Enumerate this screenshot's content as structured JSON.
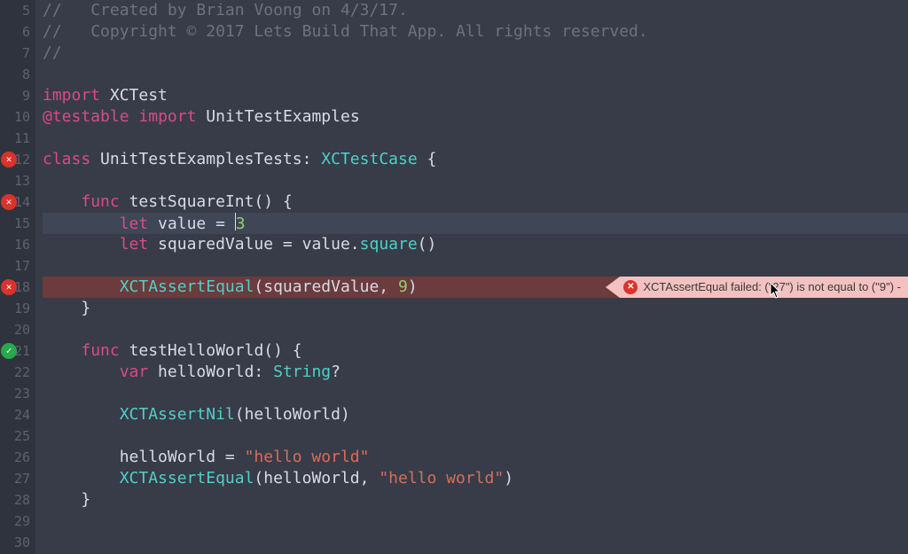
{
  "first_line_number": 5,
  "error_annotation": {
    "line_number": 18,
    "message": "XCTAssertEqual failed: (\"27\") is not equal to (\"9\") -"
  },
  "gutter_markers": [
    {
      "line_number": 12,
      "kind": "fail",
      "glyph": "✕"
    },
    {
      "line_number": 14,
      "kind": "fail",
      "glyph": "✕"
    },
    {
      "line_number": 18,
      "kind": "fail",
      "glyph": "✕"
    },
    {
      "line_number": 21,
      "kind": "pass",
      "glyph": "✓"
    }
  ],
  "current_line_number": 15,
  "error_line_number": 18,
  "lines": [
    {
      "n": 5,
      "tokens": [
        {
          "t": "// ",
          "c": "comment"
        },
        {
          "t": "  Created by Brian Voong on 4/3/17.",
          "c": "comment"
        }
      ]
    },
    {
      "n": 6,
      "tokens": [
        {
          "t": "// ",
          "c": "comment"
        },
        {
          "t": "  Copyright © 2017 Lets Build That App. All rights reserved.",
          "c": "comment"
        }
      ]
    },
    {
      "n": 7,
      "tokens": [
        {
          "t": "//",
          "c": "comment"
        }
      ]
    },
    {
      "n": 8,
      "tokens": []
    },
    {
      "n": 9,
      "tokens": [
        {
          "t": "import",
          "c": "keyword"
        },
        {
          "t": " ",
          "c": "plain"
        },
        {
          "t": "XCTest",
          "c": "plain"
        }
      ]
    },
    {
      "n": 10,
      "tokens": [
        {
          "t": "@testable",
          "c": "keyword2"
        },
        {
          "t": " ",
          "c": "plain"
        },
        {
          "t": "import",
          "c": "keyword"
        },
        {
          "t": " ",
          "c": "plain"
        },
        {
          "t": "UnitTestExamples",
          "c": "plain"
        }
      ]
    },
    {
      "n": 11,
      "tokens": []
    },
    {
      "n": 12,
      "tokens": [
        {
          "t": "class",
          "c": "keyword"
        },
        {
          "t": " ",
          "c": "plain"
        },
        {
          "t": "UnitTestExamplesTests",
          "c": "plain"
        },
        {
          "t": ": ",
          "c": "punct"
        },
        {
          "t": "XCTestCase",
          "c": "type"
        },
        {
          "t": " {",
          "c": "punct"
        }
      ]
    },
    {
      "n": 13,
      "tokens": []
    },
    {
      "n": 14,
      "tokens": [
        {
          "t": "    ",
          "c": "plain"
        },
        {
          "t": "func",
          "c": "keyword"
        },
        {
          "t": " ",
          "c": "plain"
        },
        {
          "t": "testSquareInt",
          "c": "plain"
        },
        {
          "t": "() {",
          "c": "punct"
        }
      ]
    },
    {
      "n": 15,
      "tokens": [
        {
          "t": "        ",
          "c": "plain"
        },
        {
          "t": "let",
          "c": "keyword"
        },
        {
          "t": " value = ",
          "c": "plain"
        },
        {
          "t": "|",
          "c": "cursor"
        },
        {
          "t": "3",
          "c": "number"
        }
      ]
    },
    {
      "n": 16,
      "tokens": [
        {
          "t": "        ",
          "c": "plain"
        },
        {
          "t": "let",
          "c": "keyword"
        },
        {
          "t": " squaredValue = value.",
          "c": "plain"
        },
        {
          "t": "square",
          "c": "fn"
        },
        {
          "t": "()",
          "c": "punct"
        }
      ]
    },
    {
      "n": 17,
      "tokens": []
    },
    {
      "n": 18,
      "tokens": [
        {
          "t": "        ",
          "c": "plain"
        },
        {
          "t": "XCTAssertEqual",
          "c": "fn"
        },
        {
          "t": "(squaredValue, ",
          "c": "plain"
        },
        {
          "t": "9",
          "c": "number"
        },
        {
          "t": ")",
          "c": "punct"
        }
      ]
    },
    {
      "n": 19,
      "tokens": [
        {
          "t": "    }",
          "c": "punct"
        }
      ]
    },
    {
      "n": 20,
      "tokens": []
    },
    {
      "n": 21,
      "tokens": [
        {
          "t": "    ",
          "c": "plain"
        },
        {
          "t": "func",
          "c": "keyword"
        },
        {
          "t": " ",
          "c": "plain"
        },
        {
          "t": "testHelloWorld",
          "c": "plain"
        },
        {
          "t": "() {",
          "c": "punct"
        }
      ]
    },
    {
      "n": 22,
      "tokens": [
        {
          "t": "        ",
          "c": "plain"
        },
        {
          "t": "var",
          "c": "keyword"
        },
        {
          "t": " helloWorld: ",
          "c": "plain"
        },
        {
          "t": "String",
          "c": "type"
        },
        {
          "t": "?",
          "c": "punct"
        }
      ]
    },
    {
      "n": 23,
      "tokens": []
    },
    {
      "n": 24,
      "tokens": [
        {
          "t": "        ",
          "c": "plain"
        },
        {
          "t": "XCTAssertNil",
          "c": "fn"
        },
        {
          "t": "(helloWorld)",
          "c": "plain"
        }
      ]
    },
    {
      "n": 25,
      "tokens": []
    },
    {
      "n": 26,
      "tokens": [
        {
          "t": "        helloWorld = ",
          "c": "plain"
        },
        {
          "t": "\"hello world\"",
          "c": "string"
        }
      ]
    },
    {
      "n": 27,
      "tokens": [
        {
          "t": "        ",
          "c": "plain"
        },
        {
          "t": "XCTAssertEqual",
          "c": "fn"
        },
        {
          "t": "(helloWorld, ",
          "c": "plain"
        },
        {
          "t": "\"hello world\"",
          "c": "string"
        },
        {
          "t": ")",
          "c": "punct"
        }
      ]
    },
    {
      "n": 28,
      "tokens": [
        {
          "t": "    }",
          "c": "punct"
        }
      ]
    },
    {
      "n": 29,
      "tokens": []
    },
    {
      "n": 30,
      "tokens": []
    }
  ]
}
